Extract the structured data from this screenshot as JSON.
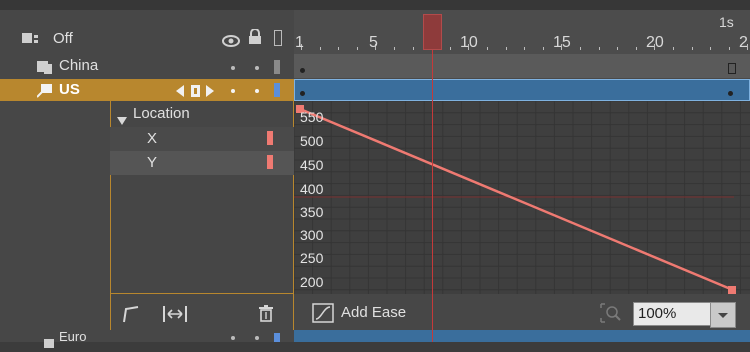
{
  "ruler": {
    "time_label": "1s",
    "frame_labels": [
      "1",
      "5",
      "10",
      "15",
      "20",
      "2"
    ]
  },
  "header": {
    "mode_label": "Off"
  },
  "layers": [
    {
      "name": "China"
    },
    {
      "name": "US"
    },
    {
      "name": "Euro"
    }
  ],
  "property_panel": {
    "group_label": "Location",
    "properties": [
      {
        "name": "X"
      },
      {
        "name": "Y"
      }
    ]
  },
  "graph": {
    "y_ticks": [
      "550",
      "500",
      "450",
      "400",
      "350",
      "300",
      "250",
      "200"
    ]
  },
  "toolbar": {
    "add_ease_label": "Add Ease",
    "zoom_value": "100%"
  },
  "colors": {
    "accent_orange": "#b8872e",
    "selected_blue": "#3a6e9c",
    "playhead_red": "#c43a3a",
    "curve_red": "#ef7a72"
  }
}
